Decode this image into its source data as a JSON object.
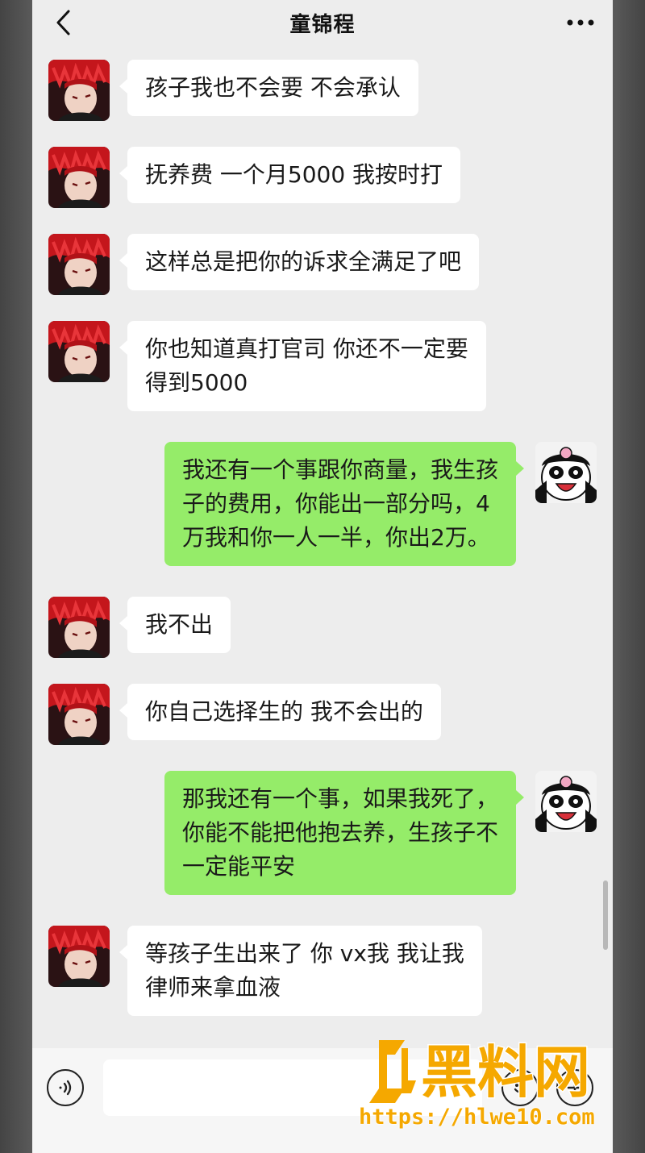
{
  "navbar": {
    "title": "童锦程",
    "back_icon": "chevron-left-icon",
    "more_icon": "more-dots-icon"
  },
  "messages": [
    {
      "side": "in",
      "text": "孩子我也不会要 不会承认"
    },
    {
      "side": "in",
      "text": "抚养费 一个月5000 我按时打"
    },
    {
      "side": "in",
      "text": "这样总是把你的诉求全满足了吧"
    },
    {
      "side": "in",
      "text": "你也知道真打官司 你还不一定要\n得到5000"
    },
    {
      "side": "out",
      "text": "我还有一个事跟你商量，我生孩\n子的费用，你能出一部分吗，4\n万我和你一人一半，你出2万。"
    },
    {
      "side": "in",
      "text": "我不出"
    },
    {
      "side": "in",
      "text": "你自己选择生的 我不会出的"
    },
    {
      "side": "out",
      "text": "那我还有一个事，如果我死了，\n你能不能把他抱去养，生孩子不\n一定能平安"
    },
    {
      "side": "in",
      "text": "等孩子生出来了 你 vx我 我让我\n律师来拿血液"
    }
  ],
  "inputbar": {
    "voice_icon": "voice-icon",
    "emoji_icon": "emoji-icon",
    "plus_icon": "plus-icon"
  },
  "watermark": {
    "brand": "黑料网",
    "url": "https://hlwe10.com",
    "color": "#f5a800"
  },
  "colors": {
    "background": "#ededed",
    "incoming_bubble": "#ffffff",
    "outgoing_bubble": "#95ec69"
  }
}
